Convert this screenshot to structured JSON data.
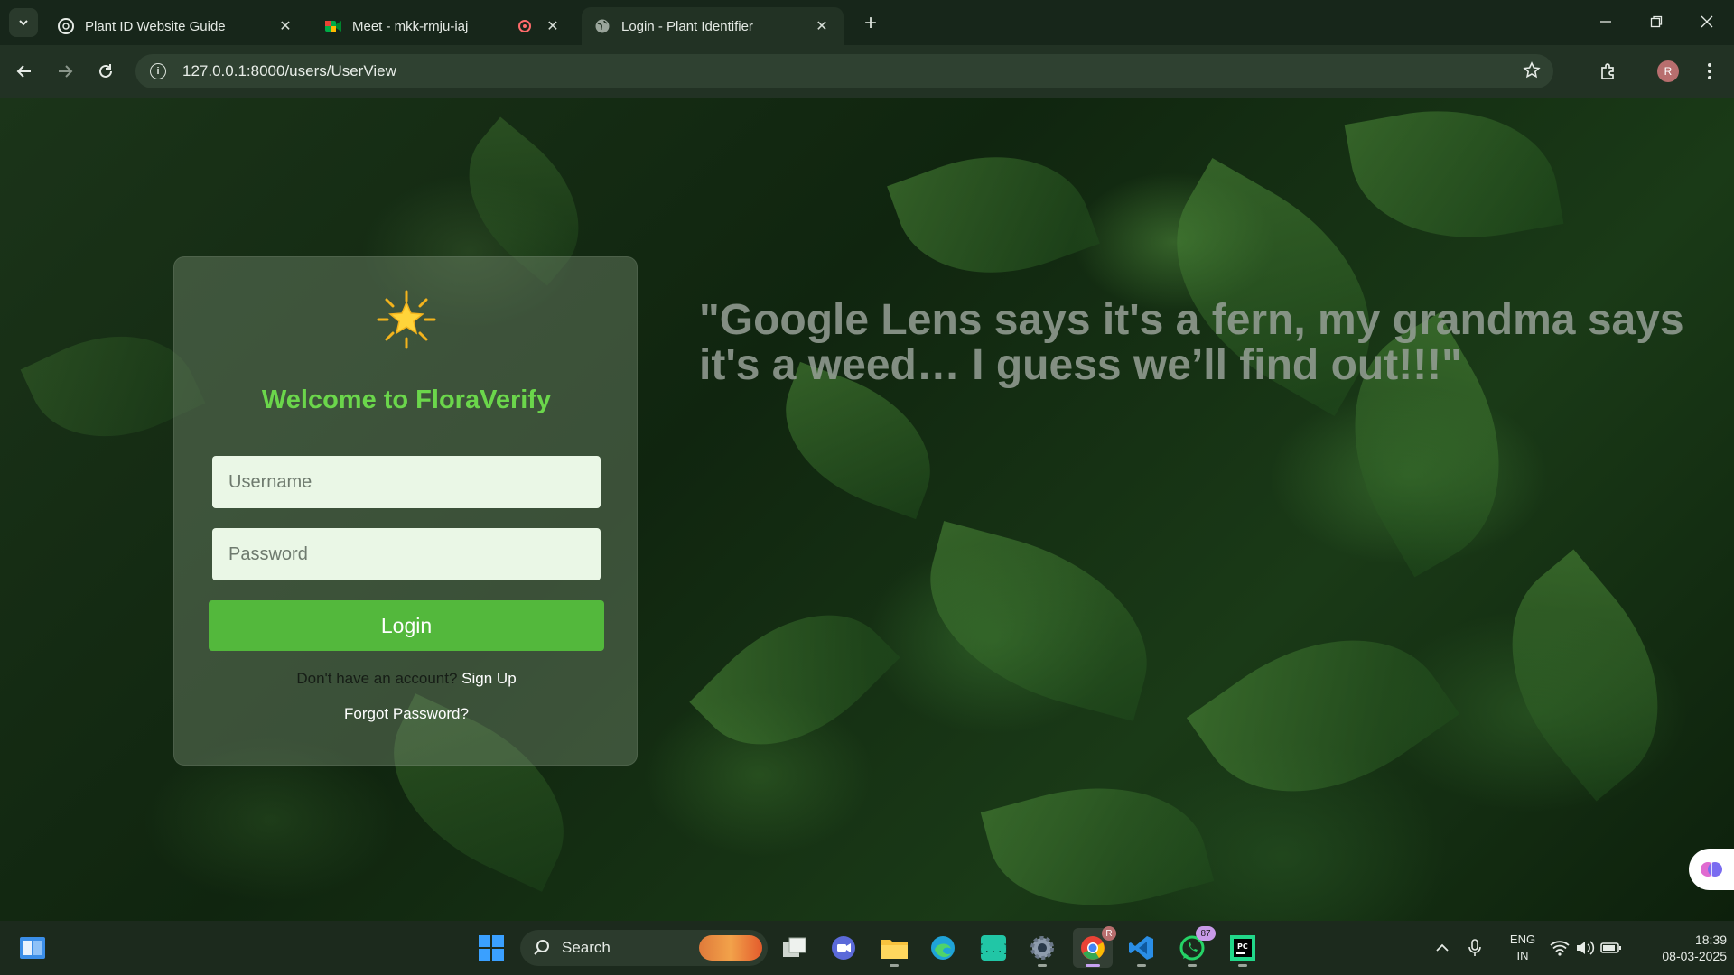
{
  "browser": {
    "tabs": [
      {
        "title": "Plant ID Website Guide",
        "icon": "chatgpt-icon",
        "active": false
      },
      {
        "title": "Meet - mkk-rmju-iaj",
        "icon": "google-meet-icon",
        "active": false,
        "recording": true
      },
      {
        "title": "Login - Plant Identifier",
        "icon": "globe-icon",
        "active": true
      }
    ],
    "address": "127.0.0.1:8000/users/UserView",
    "profile_initial": "R"
  },
  "login": {
    "title": "Welcome to FloraVerify",
    "username_placeholder": "Username",
    "password_placeholder": "Password",
    "login_label": "Login",
    "signup_prompt": "Don't have an account?",
    "signup_link": "Sign Up",
    "forgot_link": "Forgot Password?"
  },
  "quote": "\"Google Lens says it's a fern, my grandma says it's a weed… I guess we’ll find out!!!\"",
  "taskbar": {
    "search_label": "Search",
    "whatsapp_badge": "87",
    "chrome_badge": "R",
    "language": "ENG",
    "region": "IN",
    "time": "18:39",
    "date": "08-03-2025"
  },
  "colors": {
    "accent_green": "#53b83c",
    "title_green": "#6bd64b",
    "chrome_bg": "#223224"
  }
}
